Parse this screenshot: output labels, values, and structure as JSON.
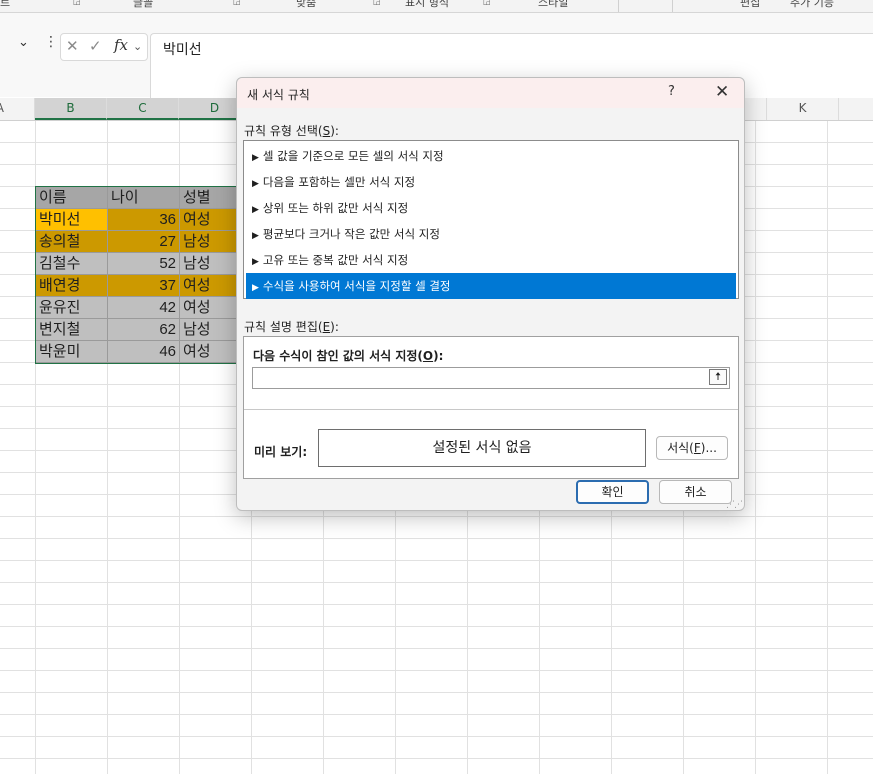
{
  "ribbon": {
    "groups": [
      "르",
      "글꼴",
      "맞춤",
      "표시 형식",
      "스타일",
      "편집",
      "추가 기능"
    ]
  },
  "formula_bar": {
    "cancel_symbol": "✕",
    "enter_symbol": "✓",
    "fx_label": "fx",
    "content": "박미선"
  },
  "columns": [
    "A",
    "B",
    "C",
    "D",
    "K"
  ],
  "selected_columns": [
    "B",
    "C",
    "D"
  ],
  "table": {
    "headers": [
      "이름",
      "나이",
      "성별"
    ],
    "rows": [
      {
        "name": "박미선",
        "age": "36",
        "gender": "여성",
        "fill": "gold"
      },
      {
        "name": "송의철",
        "age": "27",
        "gender": "남성",
        "fill": "gold"
      },
      {
        "name": "김철수",
        "age": "52",
        "gender": "남성",
        "fill": "gray"
      },
      {
        "name": "배연경",
        "age": "37",
        "gender": "여성",
        "fill": "gold"
      },
      {
        "name": "윤유진",
        "age": "42",
        "gender": "여성",
        "fill": "gray"
      },
      {
        "name": "변지철",
        "age": "62",
        "gender": "남성",
        "fill": "gray"
      },
      {
        "name": "박윤미",
        "age": "46",
        "gender": "여성",
        "fill": "gray"
      }
    ]
  },
  "dialog": {
    "title": "새 서식 규칙",
    "help": "?",
    "close": "✕",
    "rule_type_label": "규칙 유형 선택(",
    "rule_type_key": "S",
    "rule_type_label_end": "):",
    "rules": [
      "셀 값을 기준으로 모든 셀의 서식 지정",
      "다음을 포함하는 셀만 서식 지정",
      "상위 또는 하위 값만 서식 지정",
      "평균보다 크거나 작은 값만 서식 지정",
      "고유 또는 중복 값만 서식 지정",
      "수식을 사용하여 서식을 지정할 셀 결정"
    ],
    "selected_rule_index": 5,
    "edit_label": "규칙 설명 편집(",
    "edit_key": "E",
    "edit_label_end": "):",
    "formula_prompt": "다음 수식이 참인 값의 서식 지정(",
    "formula_key": "O",
    "formula_prompt_end": "):",
    "formula_value": "",
    "preview_label": "미리 보기:",
    "preview_text": "설정된 서식 없음",
    "format_button": "서식(",
    "format_key": "F",
    "format_button_end": ")...",
    "ok_button": "확인",
    "cancel_button": "취소"
  },
  "colors": {
    "accent": "#0078d4",
    "excel_green": "#217346",
    "gold_fill": "#cc9900",
    "active_fill": "#ffc000",
    "gray_fill": "#bfbfbf",
    "header_fill": "#a6a6a6"
  }
}
